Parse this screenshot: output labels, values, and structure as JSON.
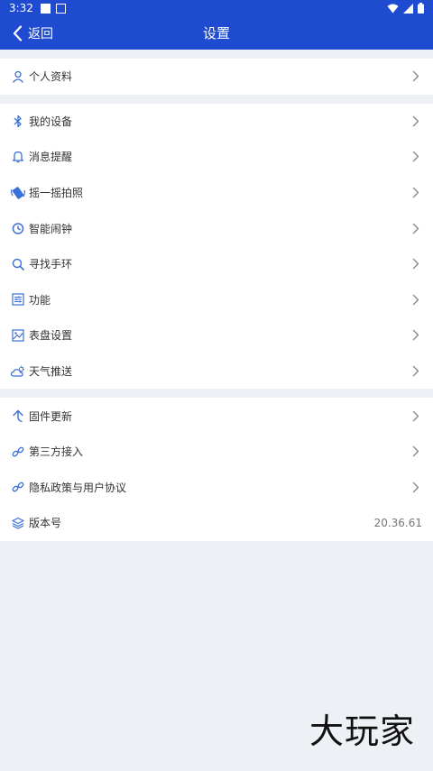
{
  "status": {
    "time": "3:32"
  },
  "header": {
    "back_label": "返回",
    "title": "设置"
  },
  "sections": [
    [
      {
        "label": "个人资料",
        "icon": "person-icon"
      }
    ],
    [
      {
        "label": "我的设备",
        "icon": "bluetooth-icon"
      },
      {
        "label": "消息提醒",
        "icon": "bell-icon"
      },
      {
        "label": "摇一摇拍照",
        "icon": "shake-phone-icon"
      },
      {
        "label": "智能闹钟",
        "icon": "alarm-clock-icon"
      },
      {
        "label": "寻找手环",
        "icon": "search-icon"
      },
      {
        "label": "功能",
        "icon": "sliders-icon"
      },
      {
        "label": "表盘设置",
        "icon": "watchface-icon"
      },
      {
        "label": "天气推送",
        "icon": "weather-icon"
      }
    ],
    [
      {
        "label": "固件更新",
        "icon": "update-arrow-icon"
      },
      {
        "label": "第三方接入",
        "icon": "link-icon"
      },
      {
        "label": "隐私政策与用户协议",
        "icon": "link-icon"
      },
      {
        "label": "版本号",
        "icon": "layers-icon",
        "value": "20.36.61"
      }
    ]
  ],
  "watermark": "大玩家",
  "colors": {
    "primary": "#1f4bd0",
    "icon": "#3a6fd8"
  }
}
